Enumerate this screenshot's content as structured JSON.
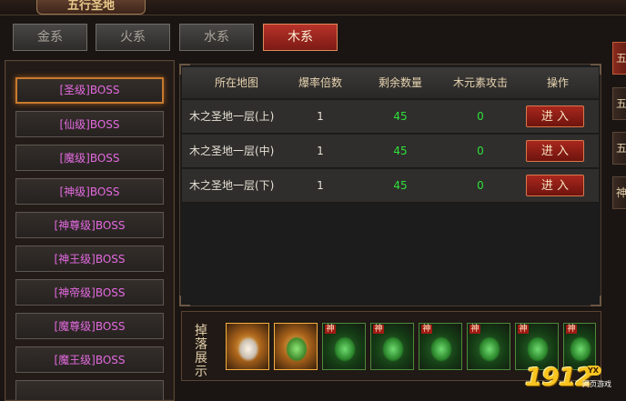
{
  "window": {
    "title": "五行圣地"
  },
  "element_tabs": [
    {
      "label": "金系",
      "active": false
    },
    {
      "label": "火系",
      "active": false
    },
    {
      "label": "水系",
      "active": false
    },
    {
      "label": "木系",
      "active": true
    }
  ],
  "right_tabs": [
    "五",
    "五",
    "五",
    "神"
  ],
  "boss_levels": [
    "[圣级]BOSS",
    "[仙级]BOSS",
    "[魔级]BOSS",
    "[神级]BOSS",
    "[神尊级]BOSS",
    "[神王级]BOSS",
    "[神帝级]BOSS",
    "[魔尊级]BOSS",
    "[魔王级]BOSS"
  ],
  "table": {
    "headers": [
      "所在地图",
      "爆率倍数",
      "剩余数量",
      "木元素攻击",
      "操作"
    ],
    "rows": [
      {
        "map": "木之圣地一层(上)",
        "multiplier": "1",
        "remaining": "45",
        "wood_attack": "0",
        "action": "进 入"
      },
      {
        "map": "木之圣地一层(中)",
        "multiplier": "1",
        "remaining": "45",
        "wood_attack": "0",
        "action": "进 入"
      },
      {
        "map": "木之圣地一层(下)",
        "multiplier": "1",
        "remaining": "45",
        "wood_attack": "0",
        "action": "进 入"
      }
    ]
  },
  "drops": {
    "label": "掉落展示",
    "items": [
      {
        "icon": "taiji-token-icon",
        "badge": ""
      },
      {
        "icon": "green-gourd-icon",
        "badge": ""
      },
      {
        "icon": "god-armor-icon",
        "badge": "神"
      },
      {
        "icon": "god-weapon-icon",
        "badge": "神"
      },
      {
        "icon": "god-helmet-icon",
        "badge": "神"
      },
      {
        "icon": "god-bracer-icon",
        "badge": "神"
      },
      {
        "icon": "god-boots-icon",
        "badge": "神"
      },
      {
        "icon": "god-ring-icon",
        "badge": "神"
      }
    ]
  },
  "logo": {
    "text": "1912",
    "badge": "YX",
    "sub": "网页游戏"
  }
}
